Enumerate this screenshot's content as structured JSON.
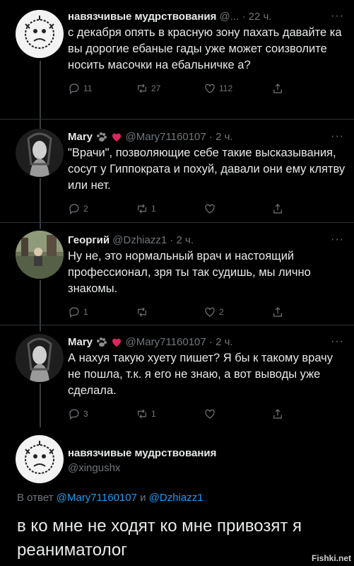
{
  "tweets": [
    {
      "name": "навязчивые мудрствования",
      "handle": "@...",
      "time": "· 22 ч.",
      "text": "с декабря опять в красную зону пахать давайте ка вы дорогие ебаные гады уже может соизволите носить масочки на ебальничке а?",
      "replies": "11",
      "retweets": "27",
      "likes": "112"
    },
    {
      "name": "Mary",
      "handle": "@Mary71160107",
      "time": "· 2 ч.",
      "text": "\"Врачи\", позволяющие себе такие высказывания, сосут у Гиппократа и похуй, давали они ему клятву или нет.",
      "replies": "2",
      "retweets": "1",
      "likes": ""
    },
    {
      "name": "Георгий",
      "handle": "@Dzhiazz1",
      "time": "· 2 ч.",
      "text": "Ну не, это нормальный врач и настоящий профессионал, зря ты так судишь, мы лично знакомы.",
      "replies": "1",
      "retweets": "",
      "likes": "2"
    },
    {
      "name": "Mary",
      "handle": "@Mary71160107",
      "time": "· 2 ч.",
      "text": "А нахуя такую хуету пишет? Я бы к такому врачу не пошла, т.к. я его не знаю, а вот выводы уже сделала.",
      "replies": "3",
      "retweets": "1",
      "likes": ""
    }
  ],
  "main_tweet": {
    "name": "навязчивые мудрствования",
    "handle": "@xingushx",
    "reply_prefix": "В ответ",
    "reply_to_1": "@Mary71160107",
    "reply_and": "и",
    "reply_to_2": "@Dzhiazz1",
    "text": "в ко мне не ходят ко мне привозят я реаниматолог"
  },
  "more_label": "···",
  "watermark": "Fishki.net",
  "icons": [
    "reply-icon",
    "retweet-icon",
    "like-icon",
    "share-icon",
    "paw-icon",
    "heart-icon"
  ],
  "colors": {
    "background": "#000000",
    "text": "#e7e9ea",
    "secondary": "#71767b",
    "link": "#1d9bf0",
    "heart": "#e0245e"
  }
}
